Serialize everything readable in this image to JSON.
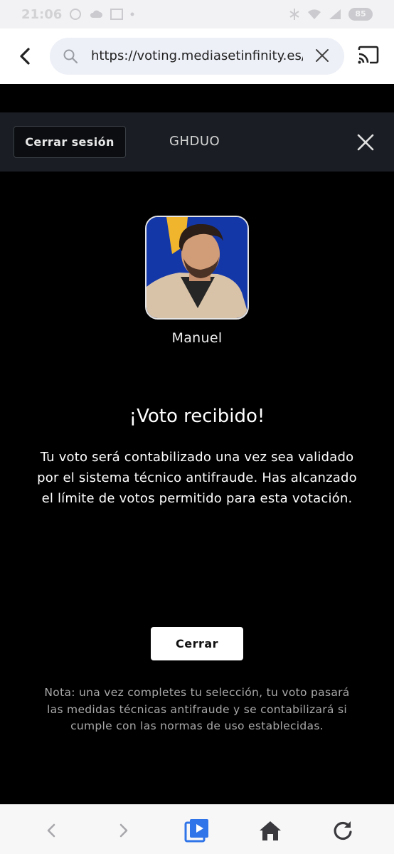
{
  "status_bar": {
    "time": "21:06",
    "icons_left": [
      "whatsapp-icon",
      "cloud-icon",
      "picture-icon",
      "dot-icon"
    ],
    "icons_right": [
      "alarm-icon",
      "wifi-icon",
      "signal-icon",
      "battery-icon"
    ],
    "battery": "85"
  },
  "browser": {
    "url": "https://voting.mediasetinfinity.es/c",
    "icons": [
      "back-arrow-icon",
      "search-icon",
      "clear-icon",
      "cast-icon"
    ]
  },
  "header": {
    "logout_label": "Cerrar sesión",
    "program": "GHDUO",
    "close_icon": "close-icon"
  },
  "candidate": {
    "name": "Manuel",
    "accent_colors": [
      "#1437a8",
      "#f0b52c"
    ]
  },
  "vote": {
    "title": "¡Voto recibido!",
    "message": "Tu voto será contabilizado una vez sea validado por el sistema técnico antifraude. Has alcanzado el límite de votos permitido para esta votación."
  },
  "close_button": "Cerrar",
  "note": "Nota: una vez completes tu selección, tu voto pasará las medidas técnicas antifraude y se contabilizará si cumple con las normas de uso establecidas.",
  "bottom_nav": [
    "back-icon",
    "forward-icon",
    "media-icon",
    "home-icon",
    "reload-icon"
  ]
}
